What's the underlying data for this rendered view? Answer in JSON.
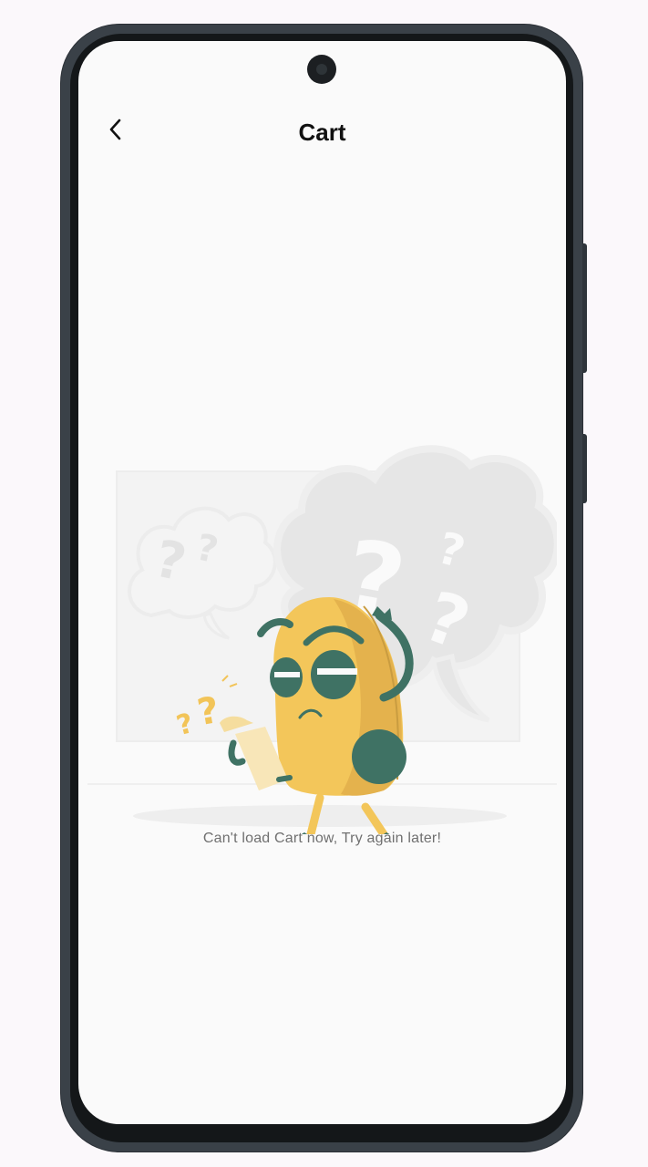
{
  "header": {
    "title": "Cart",
    "back_icon": "chevron-left-icon"
  },
  "empty_state": {
    "illustration": "confused-character-illustration",
    "message": "Can't load Cart now, Try again later!"
  },
  "colors": {
    "screen_bg": "#fafafa",
    "frame": "#3a4148",
    "character_yellow": "#f3c65a",
    "character_green": "#3f7264"
  }
}
